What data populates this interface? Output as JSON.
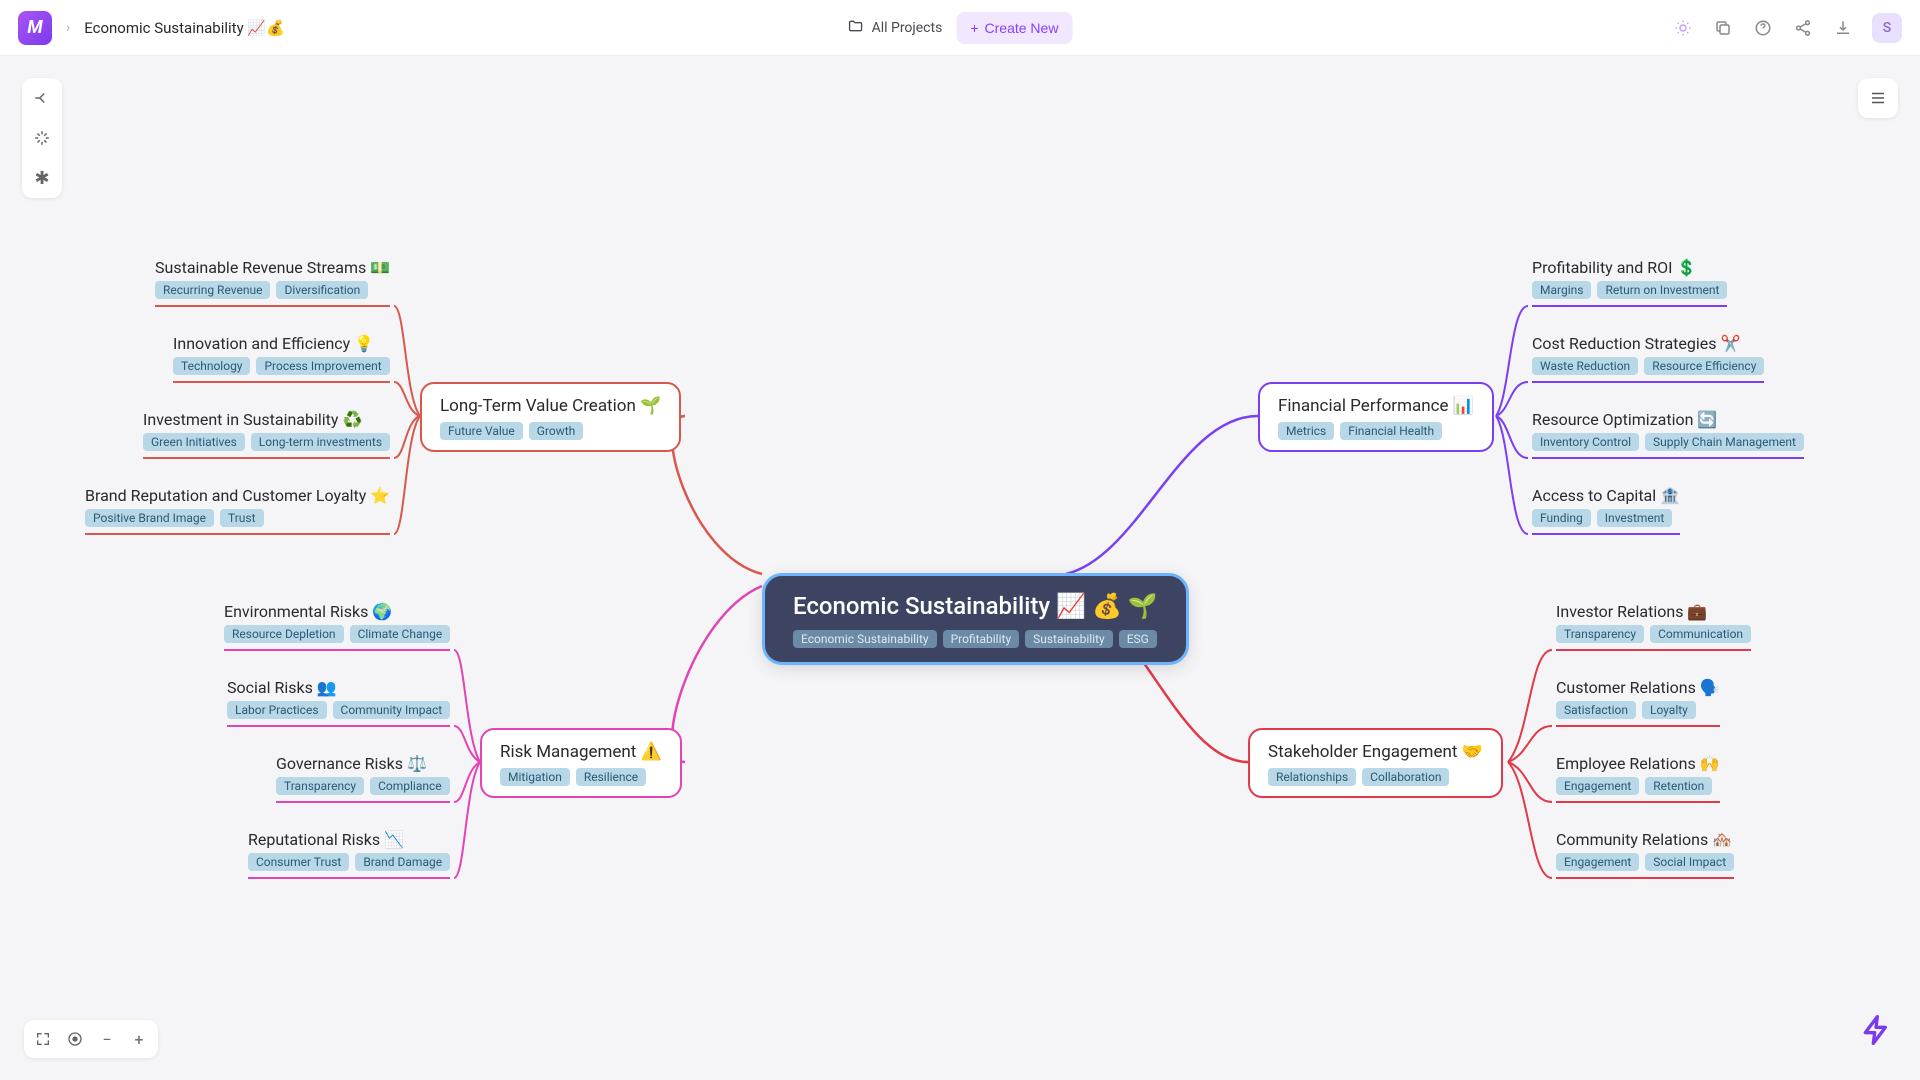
{
  "header": {
    "title": "Economic Sustainability 📈💰",
    "all_projects": "All Projects",
    "create_new": "Create New",
    "avatar_letter": "S"
  },
  "central": {
    "title": "Economic Sustainability 📈 💰 🌱",
    "tags": [
      "Economic Sustainability",
      "Profitability",
      "Sustainability",
      "ESG"
    ]
  },
  "branches": {
    "fp": {
      "title": "Financial Performance 📊",
      "tags": [
        "Metrics",
        "Financial Health"
      ],
      "color": "#7b3ff2"
    },
    "se": {
      "title": "Stakeholder Engagement 🤝",
      "tags": [
        "Relationships",
        "Collaboration"
      ],
      "color": "#e2394a"
    },
    "lt": {
      "title": "Long-Term Value Creation 🌱",
      "tags": [
        "Future Value",
        "Growth"
      ],
      "color": "#d9584d"
    },
    "rm": {
      "title": "Risk Management ⚠️",
      "tags": [
        "Mitigation",
        "Resilience"
      ],
      "color": "#e244b5"
    }
  },
  "leaves": {
    "fp1": {
      "title": "Profitability and ROI 💲",
      "tags": [
        "Margins",
        "Return on Investment"
      ]
    },
    "fp2": {
      "title": "Cost Reduction Strategies ✂️",
      "tags": [
        "Waste Reduction",
        "Resource Efficiency"
      ]
    },
    "fp3": {
      "title": "Resource Optimization 🔄",
      "tags": [
        "Inventory Control",
        "Supply Chain Management"
      ]
    },
    "fp4": {
      "title": "Access to Capital 🏦",
      "tags": [
        "Funding",
        "Investment"
      ]
    },
    "se1": {
      "title": "Investor Relations 💼",
      "tags": [
        "Transparency",
        "Communication"
      ]
    },
    "se2": {
      "title": "Customer Relations 🗣️",
      "tags": [
        "Satisfaction",
        "Loyalty"
      ]
    },
    "se3": {
      "title": "Employee Relations 🙌",
      "tags": [
        "Engagement",
        "Retention"
      ]
    },
    "se4": {
      "title": "Community Relations 🏘️",
      "tags": [
        "Engagement",
        "Social Impact"
      ]
    },
    "lt1": {
      "title": "Sustainable Revenue Streams 💵",
      "tags": [
        "Recurring Revenue",
        "Diversification"
      ]
    },
    "lt2": {
      "title": "Innovation and Efficiency 💡",
      "tags": [
        "Technology",
        "Process Improvement"
      ]
    },
    "lt3": {
      "title": "Investment in Sustainability ♻️",
      "tags": [
        "Green Initiatives",
        "Long-term investments"
      ]
    },
    "lt4": {
      "title": "Brand Reputation and Customer Loyalty ⭐",
      "tags": [
        "Positive Brand Image",
        "Trust"
      ]
    },
    "rm1": {
      "title": "Environmental Risks 🌍",
      "tags": [
        "Resource Depletion",
        "Climate Change"
      ]
    },
    "rm2": {
      "title": "Social Risks 👥",
      "tags": [
        "Labor Practices",
        "Community Impact"
      ]
    },
    "rm3": {
      "title": "Governance Risks ⚖️",
      "tags": [
        "Transparency",
        "Compliance"
      ]
    },
    "rm4": {
      "title": "Reputational Risks 📉",
      "tags": [
        "Consumer Trust",
        "Brand Damage"
      ]
    }
  }
}
